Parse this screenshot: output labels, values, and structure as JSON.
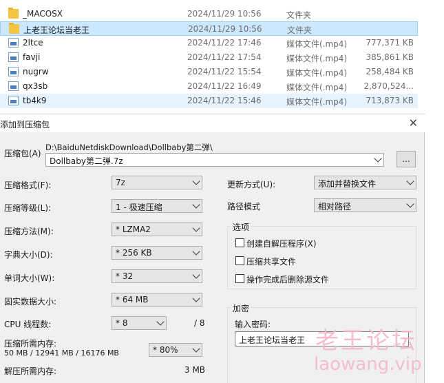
{
  "explorer": {
    "files": [
      {
        "name": "_MACOSX",
        "date": "2024/11/29 10:56",
        "type": "文件夹",
        "size": "",
        "icon": "folder-icon"
      },
      {
        "name": "上老王论坛当老王",
        "date": "2024/11/29 10:56",
        "type": "文件夹",
        "size": "",
        "icon": "folder-icon"
      },
      {
        "name": "2ltce",
        "date": "2024/11/22 17:46",
        "type": "媒体文件(.mp4)",
        "size": "777,371 KB",
        "icon": "media-file-icon"
      },
      {
        "name": "favji",
        "date": "2024/11/22 17:54",
        "type": "媒体文件(.mp4)",
        "size": "385,861 KB",
        "icon": "media-file-icon"
      },
      {
        "name": "nugrw",
        "date": "2024/11/22 15:54",
        "type": "媒体文件(.mp4)",
        "size": "258,484 KB",
        "icon": "media-file-icon"
      },
      {
        "name": "qx3sb",
        "date": "2024/11/22 16:49",
        "type": "媒体文件(.mp4)",
        "size": "2,870,524...",
        "icon": "media-file-icon"
      },
      {
        "name": "tb4k9",
        "date": "2024/11/22 15:46",
        "type": "媒体文件(.mp4)",
        "size": "713,873 KB",
        "icon": "media-file-icon"
      }
    ]
  },
  "dialog": {
    "title": "添加到压缩包",
    "archive_label": "压缩包(A)",
    "archive_path": "D:\\BaiduNetdiskDownload\\Dollbaby第二弹\\",
    "archive_name": "Dollbaby第二弹.7z",
    "browse_label": "...",
    "format_label": "压缩格式(F):",
    "format_value": "7z",
    "level_label": "压缩等级(L):",
    "level_value": "1 - 极速压缩",
    "method_label": "压缩方法(M):",
    "method_value": "* LZMA2",
    "dict_label": "字典大小(D):",
    "dict_value": "* 256 KB",
    "word_label": "单词大小(W):",
    "word_value": "* 32",
    "solid_label": "固实数据大小:",
    "solid_value": "* 64 MB",
    "threads_label": "CPU 线程数:",
    "threads_value": "* 8",
    "threads_total": "/ 8",
    "mem_label": "压缩所需内存:",
    "mem_value": "50 MB / 12941 MB / 16176 MB",
    "mem_percent": "* 80%",
    "decomp_label": "解压所需内存:",
    "decomp_value": "3 MB",
    "update_label": "更新方式(U):",
    "update_value": "添加并替换文件",
    "pathmode_label": "路径模式",
    "pathmode_value": "相对路径",
    "options_title": "选项",
    "options": [
      "创建自解压程序(X)",
      "压缩共享文件",
      "操作完成后删除源文件"
    ],
    "encrypt_title": "加密",
    "password_label": "输入密码:",
    "password_value": "上老王论坛当老王",
    "close_icon": "close-icon"
  },
  "watermark": {
    "cn": "老王论坛",
    "en": "laowang.vip"
  }
}
